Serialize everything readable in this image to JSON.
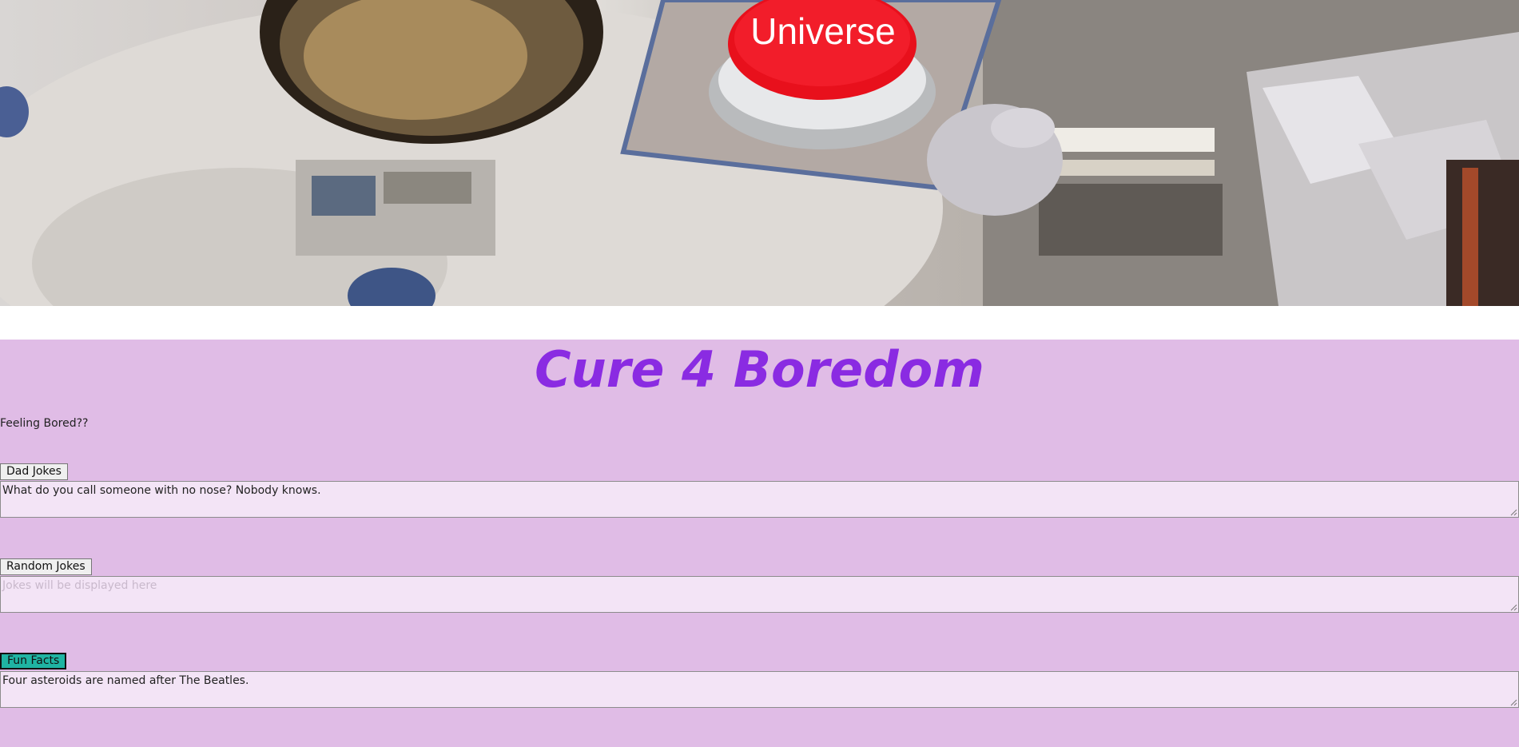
{
  "hero": {
    "button_text": "Universe"
  },
  "page": {
    "title": "Cure 4 Boredom",
    "subtitle": "Feeling Bored??"
  },
  "sections": [
    {
      "button_label": "Dad Jokes",
      "output_value": "What do you call someone with no nose? Nobody knows.",
      "placeholder": ""
    },
    {
      "button_label": "Random Jokes",
      "output_value": "",
      "placeholder": "Jokes will be displayed here"
    },
    {
      "button_label": "Fun Facts",
      "output_value": "Four asteroids are named after The Beatles.",
      "placeholder": ""
    }
  ],
  "colors": {
    "panel_bg": "#e0bce6",
    "title": "#8a2be2",
    "active_button": "#1fb4a3"
  }
}
